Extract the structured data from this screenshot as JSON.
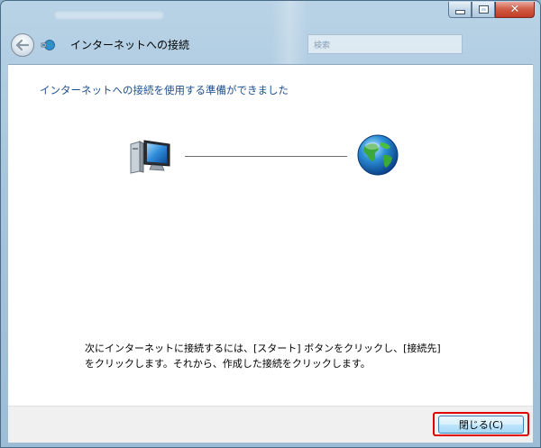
{
  "window": {
    "title": "インターネットへの接続",
    "caption_buttons": {
      "minimize_icon": "minimize-icon",
      "maximize_icon": "maximize-icon",
      "close_icon": "close-icon"
    },
    "background_search_placeholder": "検索"
  },
  "header": {
    "back_icon": "back-arrow-icon",
    "app_icon": "network-connection-icon"
  },
  "content": {
    "heading": "インターネットへの接続を使用する準備ができました",
    "left_icon": "computer-icon",
    "right_icon": "globe-icon",
    "description": "次にインターネットに接続するには、[スタート] ボタンをクリックし、[接続先] をクリックします。それから、作成した接続をクリックします。"
  },
  "footer": {
    "close_label": "閉じる(C)",
    "highlight_color": "#e00000"
  },
  "colors": {
    "heading_blue": "#1e4f8e",
    "frame_blue": "#a7c5dc"
  }
}
